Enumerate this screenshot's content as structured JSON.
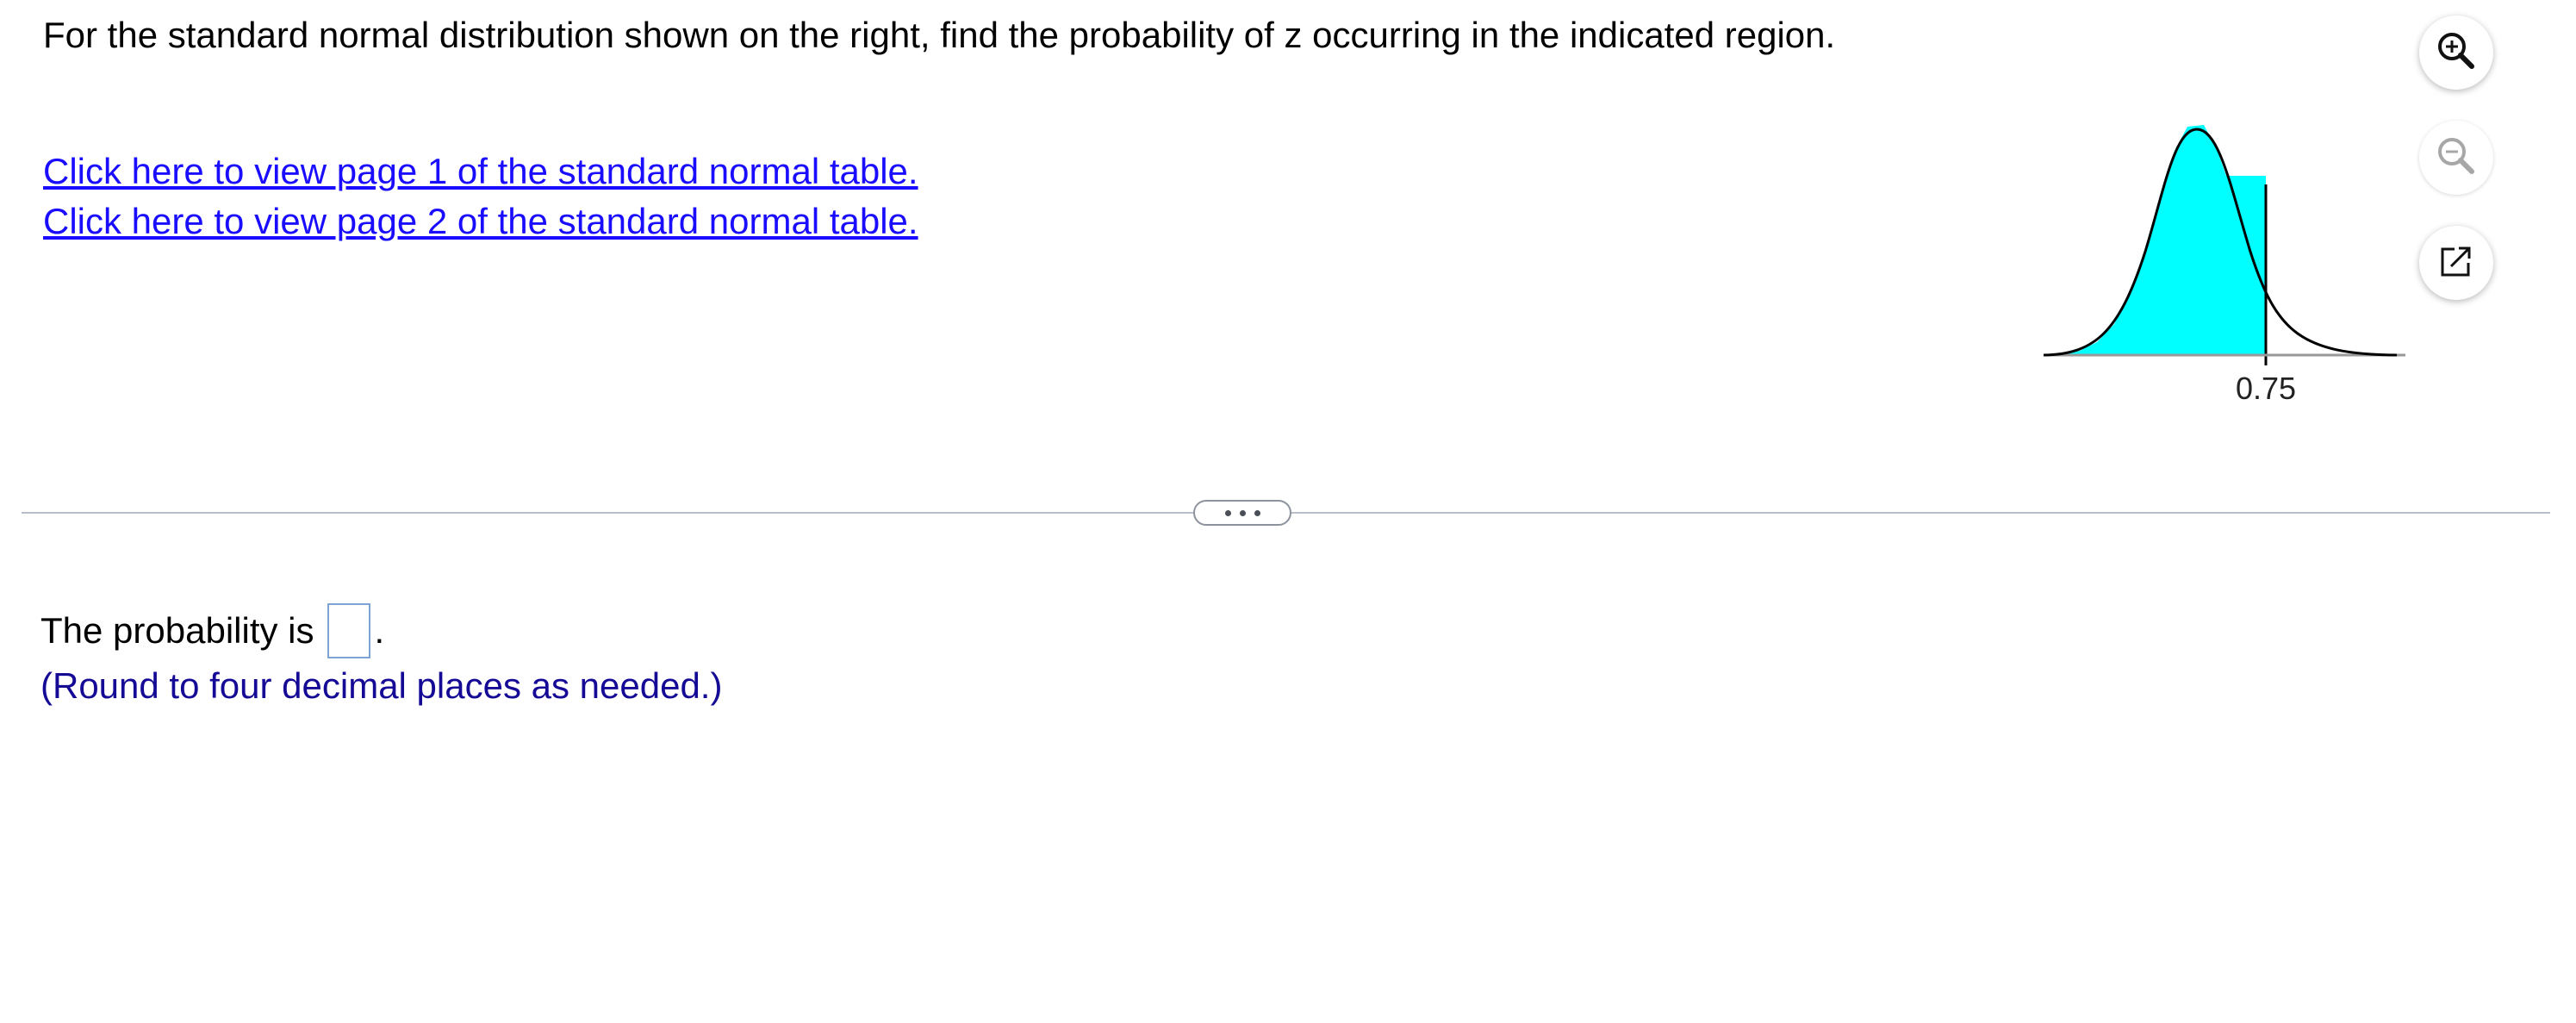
{
  "question": {
    "text": "For the standard normal distribution shown on the right, find the probability of z occurring in the indicated region."
  },
  "links": [
    {
      "label": "Click here to view page 1 of the standard normal table."
    },
    {
      "label": "Click here to view page 2 of the standard normal table."
    }
  ],
  "figure": {
    "z_value_label": "0.75",
    "shaded_region": "left of z",
    "fill_color": "#00ffff"
  },
  "tools": [
    {
      "name": "zoom-in-icon"
    },
    {
      "name": "zoom-out-icon",
      "disabled": true
    },
    {
      "name": "popout-icon"
    }
  ],
  "answer": {
    "prefix": "The probability is",
    "value": "",
    "suffix": ".",
    "hint": "(Round to four decimal places as needed.)"
  }
}
